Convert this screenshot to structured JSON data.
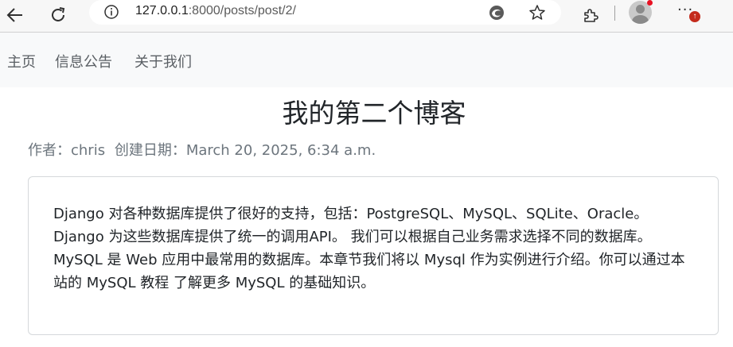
{
  "browser": {
    "url_host": "127.0.0.1",
    "url_path": ":8000/posts/post/2/",
    "update_badge": "↑"
  },
  "nav": {
    "items": [
      "主页",
      "信息公告",
      "关于我们"
    ]
  },
  "post": {
    "title": "我的第二个博客",
    "author_label": "作者：chris",
    "date_label": "创建日期：March 20, 2025, 6:34 a.m.",
    "body": "Django 对各种数据库提供了很好的支持，包括：PostgreSQL、MySQL、SQLite、Oracle。 Django 为这些数据库提供了统一的调用API。 我们可以根据自己业务需求选择不同的数据库。 MySQL 是 Web 应用中最常用的数据库。本章节我们将以 Mysql 作为实例进行介绍。你可以通过本站的 MySQL 教程 了解更多 MySQL 的基础知识。"
  }
}
